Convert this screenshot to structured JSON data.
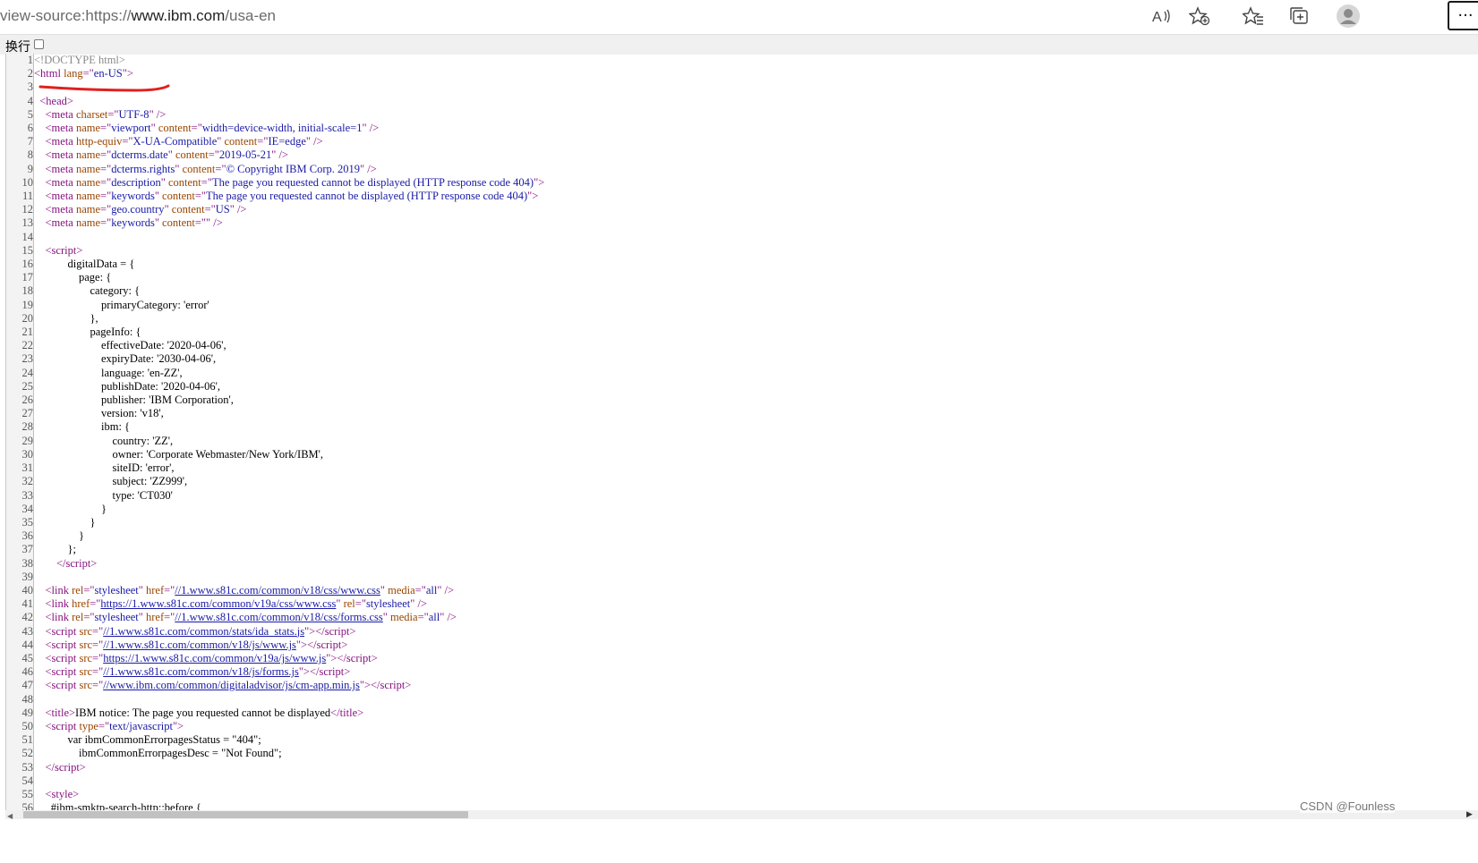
{
  "toolbar": {
    "url_prefix": "view-source:https://",
    "url_host": "www.ibm.com",
    "url_path": "/usa-en",
    "icons": [
      "read-aloud-icon",
      "add-favorite-icon",
      "favorites-icon",
      "collections-icon",
      "profile-avatar-icon",
      "more-icon"
    ],
    "more_label": "···"
  },
  "wrap": {
    "label": "换行",
    "checked": false
  },
  "source_lines": [
    {
      "n": "1",
      "h": "<span class='cm'>&lt;!DOCTYPE html&gt;</span>"
    },
    {
      "n": "2",
      "h": "<span class='tag'>&lt;html </span><span class='an'>lang</span><span class='tag'>=\"</span><span class='av'>en-US</span><span class='tag'>\"&gt;</span>"
    },
    {
      "n": "3",
      "h": ""
    },
    {
      "n": "4",
      "h": "  <span class='tag'>&lt;head&gt;</span>"
    },
    {
      "n": "5",
      "h": "    <span class='tag'>&lt;meta </span><span class='an'>charset</span><span class='tag'>=\"</span><span class='av'>UTF-8</span><span class='tag'>\" /&gt;</span>"
    },
    {
      "n": "6",
      "h": "    <span class='tag'>&lt;meta </span><span class='an'>name</span><span class='tag'>=\"</span><span class='av'>viewport</span><span class='tag'>\" </span><span class='an'>content</span><span class='tag'>=\"</span><span class='av'>width=device-width, initial-scale=1</span><span class='tag'>\" /&gt;</span>"
    },
    {
      "n": "7",
      "h": "    <span class='tag'>&lt;meta </span><span class='an'>http-equiv</span><span class='tag'>=\"</span><span class='av'>X-UA-Compatible</span><span class='tag'>\" </span><span class='an'>content</span><span class='tag'>=\"</span><span class='av'>IE=edge</span><span class='tag'>\" /&gt;</span>"
    },
    {
      "n": "8",
      "h": "    <span class='tag'>&lt;meta </span><span class='an'>name</span><span class='tag'>=\"</span><span class='av'>dcterms.date</span><span class='tag'>\" </span><span class='an'>content</span><span class='tag'>=\"</span><span class='av'>2019-05-21</span><span class='tag'>\" /&gt;</span>"
    },
    {
      "n": "9",
      "h": "    <span class='tag'>&lt;meta </span><span class='an'>name</span><span class='tag'>=\"</span><span class='av'>dcterms.rights</span><span class='tag'>\" </span><span class='an'>content</span><span class='tag'>=\"</span><span class='av'>© Copyright IBM Corp. 2019</span><span class='tag'>\" /&gt;</span>"
    },
    {
      "n": "10",
      "h": "    <span class='tag'>&lt;meta </span><span class='an'>name</span><span class='tag'>=\"</span><span class='av'>description</span><span class='tag'>\" </span><span class='an'>content</span><span class='tag'>=\"</span><span class='av'>The page you requested cannot be displayed (HTTP response code 404)</span><span class='tag'>\"&gt;</span>"
    },
    {
      "n": "11",
      "h": "    <span class='tag'>&lt;meta </span><span class='an'>name</span><span class='tag'>=\"</span><span class='av'>keywords</span><span class='tag'>\" </span><span class='an'>content</span><span class='tag'>=\"</span><span class='av'>The page you requested cannot be displayed (HTTP response code 404)</span><span class='tag'>\"&gt;</span>"
    },
    {
      "n": "12",
      "h": "    <span class='tag'>&lt;meta </span><span class='an'>name</span><span class='tag'>=\"</span><span class='av'>geo.country</span><span class='tag'>\" </span><span class='an'>content</span><span class='tag'>=\"</span><span class='av'>US</span><span class='tag'>\" /&gt;</span>"
    },
    {
      "n": "13",
      "h": "    <span class='tag'>&lt;meta </span><span class='an'>name</span><span class='tag'>=\"</span><span class='av'>keywords</span><span class='tag'>\" </span><span class='an'>content</span><span class='tag'>=\"\" /&gt;</span>"
    },
    {
      "n": "14",
      "h": ""
    },
    {
      "n": "15",
      "h": "    <span class='tag'>&lt;script&gt;</span>"
    },
    {
      "n": "16",
      "h": "            digitalData = {"
    },
    {
      "n": "17",
      "h": "                page: {"
    },
    {
      "n": "18",
      "h": "                    category: {"
    },
    {
      "n": "19",
      "h": "                        primaryCategory: 'error'"
    },
    {
      "n": "20",
      "h": "                    },"
    },
    {
      "n": "21",
      "h": "                    pageInfo: {"
    },
    {
      "n": "22",
      "h": "                        effectiveDate: '2020-04-06',"
    },
    {
      "n": "23",
      "h": "                        expiryDate: '2030-04-06',"
    },
    {
      "n": "24",
      "h": "                        language: 'en-ZZ',"
    },
    {
      "n": "25",
      "h": "                        publishDate: '2020-04-06',"
    },
    {
      "n": "26",
      "h": "                        publisher: 'IBM Corporation',"
    },
    {
      "n": "27",
      "h": "                        version: 'v18',"
    },
    {
      "n": "28",
      "h": "                        ibm: {"
    },
    {
      "n": "29",
      "h": "                            country: 'ZZ',"
    },
    {
      "n": "30",
      "h": "                            owner: 'Corporate Webmaster/New York/IBM',"
    },
    {
      "n": "31",
      "h": "                            siteID: 'error',"
    },
    {
      "n": "32",
      "h": "                            subject: 'ZZ999',"
    },
    {
      "n": "33",
      "h": "                            type: 'CT030'"
    },
    {
      "n": "34",
      "h": "                        }"
    },
    {
      "n": "35",
      "h": "                    }"
    },
    {
      "n": "36",
      "h": "                }"
    },
    {
      "n": "37",
      "h": "            };"
    },
    {
      "n": "38",
      "h": "        <span class='tag'>&lt;/script&gt;</span>"
    },
    {
      "n": "39",
      "h": ""
    },
    {
      "n": "40",
      "h": "    <span class='tag'>&lt;link </span><span class='an'>rel</span><span class='tag'>=\"</span><span class='av'>stylesheet</span><span class='tag'>\" </span><span class='an'>href</span><span class='tag'>=\"</span><span class='lk'>//1.www.s81c.com/common/v18/css/www.css</span><span class='tag'>\" </span><span class='an'>media</span><span class='tag'>=\"</span><span class='av'>all</span><span class='tag'>\" /&gt;</span>"
    },
    {
      "n": "41",
      "h": "    <span class='tag'>&lt;link </span><span class='an'>href</span><span class='tag'>=\"</span><span class='lk'>https://1.www.s81c.com/common/v19a/css/www.css</span><span class='tag'>\" </span><span class='an'>rel</span><span class='tag'>=\"</span><span class='av'>stylesheet</span><span class='tag'>\" /&gt;</span>"
    },
    {
      "n": "42",
      "h": "    <span class='tag'>&lt;link </span><span class='an'>rel</span><span class='tag'>=\"</span><span class='av'>stylesheet</span><span class='tag'>\" </span><span class='an'>href</span><span class='tag'>=\"</span><span class='lk'>//1.www.s81c.com/common/v18/css/forms.css</span><span class='tag'>\" </span><span class='an'>media</span><span class='tag'>=\"</span><span class='av'>all</span><span class='tag'>\" /&gt;</span>"
    },
    {
      "n": "43",
      "h": "    <span class='tag'>&lt;script </span><span class='an'>src</span><span class='tag'>=\"</span><span class='lk'>//1.www.s81c.com/common/stats/ida_stats.js</span><span class='tag'>\"&gt;&lt;/script&gt;</span>"
    },
    {
      "n": "44",
      "h": "    <span class='tag'>&lt;script </span><span class='an'>src</span><span class='tag'>=\"</span><span class='lk'>//1.www.s81c.com/common/v18/js/www.js</span><span class='tag'>\"&gt;&lt;/script&gt;</span>"
    },
    {
      "n": "45",
      "h": "    <span class='tag'>&lt;script </span><span class='an'>src</span><span class='tag'>=\"</span><span class='lk'>https://1.www.s81c.com/common/v19a/js/www.js</span><span class='tag'>\"&gt;&lt;/script&gt;</span>"
    },
    {
      "n": "46",
      "h": "    <span class='tag'>&lt;script </span><span class='an'>src</span><span class='tag'>=\"</span><span class='lk'>//1.www.s81c.com/common/v18/js/forms.js</span><span class='tag'>\"&gt;&lt;/script&gt;</span>"
    },
    {
      "n": "47",
      "h": "    <span class='tag'>&lt;script </span><span class='an'>src</span><span class='tag'>=\"</span><span class='lk'>//www.ibm.com/common/digitaladvisor/js/cm-app.min.js</span><span class='tag'>\"&gt;&lt;/script&gt;</span>"
    },
    {
      "n": "48",
      "h": ""
    },
    {
      "n": "49",
      "h": "    <span class='tag'>&lt;title&gt;</span>IBM notice: The page you requested cannot be displayed<span class='tag'>&lt;/title&gt;</span>"
    },
    {
      "n": "50",
      "h": "    <span class='tag'>&lt;script </span><span class='an'>type</span><span class='tag'>=\"</span><span class='av'>text/javascript</span><span class='tag'>\"&gt;</span>"
    },
    {
      "n": "51",
      "h": "            var ibmCommonErrorpagesStatus = \"404\";"
    },
    {
      "n": "52",
      "h": "                ibmCommonErrorpagesDesc = \"Not Found\";"
    },
    {
      "n": "53",
      "h": "    <span class='tag'>&lt;/script&gt;</span>"
    },
    {
      "n": "54",
      "h": ""
    },
    {
      "n": "55",
      "h": "    <span class='tag'>&lt;style&gt;</span>"
    },
    {
      "n": "56",
      "h": "      #ibm-smktp-search-http::before {"
    }
  ],
  "watermark": "CSDN @Founless",
  "annotation_color": "#e02020"
}
